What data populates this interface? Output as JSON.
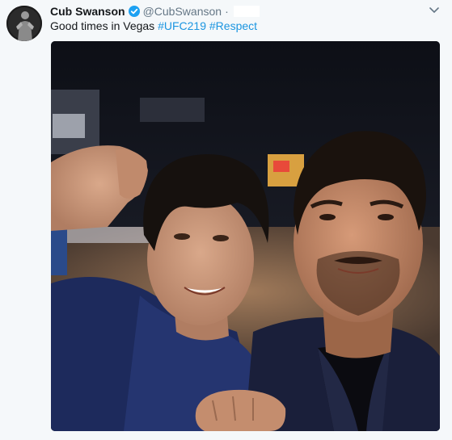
{
  "tweet": {
    "display_name": "Cub Swanson",
    "handle": "@CubSwanson",
    "separator": "·",
    "text": "Good times in Vegas",
    "hashtags": [
      "#UFC219",
      "#Respect"
    ]
  },
  "icons": {
    "verified": "verified-badge-icon",
    "more": "chevron-down-icon"
  },
  "colors": {
    "name": "#14171a",
    "secondary": "#657786",
    "link": "#1b95e0",
    "verified": "#1da1f2",
    "background": "#f5f8fa"
  }
}
